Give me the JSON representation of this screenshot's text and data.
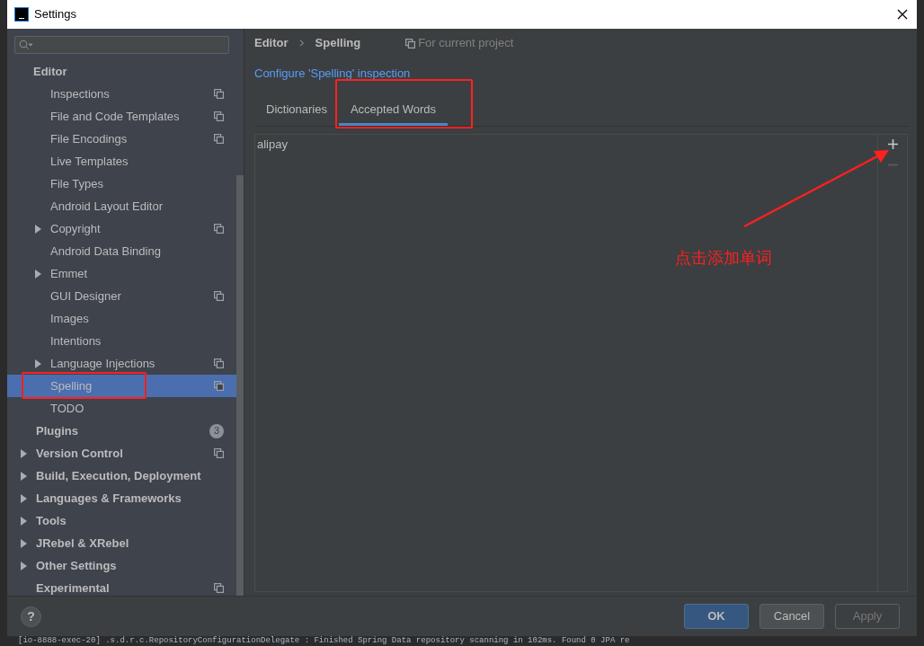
{
  "window": {
    "title": "Settings"
  },
  "help": {
    "label": "?"
  },
  "sidebar": {
    "items": [
      {
        "label": "Editor",
        "selected": false,
        "children": [
          {
            "label": "Inspections",
            "selected": false,
            "project_scope": true
          },
          {
            "label": "File and Code Templates",
            "selected": false,
            "project_scope": true
          },
          {
            "label": "File Encodings",
            "selected": false,
            "project_scope": true
          },
          {
            "label": "Live Templates",
            "selected": false
          },
          {
            "label": "File Types",
            "selected": false
          },
          {
            "label": "Android Layout Editor",
            "selected": false
          },
          {
            "label": "Copyright",
            "selected": false,
            "project_scope": true,
            "expanded": false
          },
          {
            "label": "Android Data Binding",
            "selected": false
          },
          {
            "label": "Emmet",
            "selected": false,
            "expanded": false
          },
          {
            "label": "GUI Designer",
            "selected": false,
            "project_scope": true
          },
          {
            "label": "Images",
            "selected": false
          },
          {
            "label": "Intentions",
            "selected": false
          },
          {
            "label": "Language Injections",
            "selected": false,
            "project_scope": true,
            "expanded": false
          },
          {
            "label": "Spelling",
            "selected": true,
            "project_scope": true,
            "highlighted": true
          },
          {
            "label": "TODO",
            "selected": false
          }
        ]
      },
      {
        "label": "Plugins",
        "selected": false,
        "badge": "3"
      },
      {
        "label": "Version Control",
        "selected": false,
        "project_scope": true,
        "expanded": false
      },
      {
        "label": "Build, Execution, Deployment",
        "selected": false,
        "expanded": false
      },
      {
        "label": "Languages & Frameworks",
        "selected": false,
        "expanded": false
      },
      {
        "label": "Tools",
        "selected": false,
        "expanded": false
      },
      {
        "label": "JRebel & XRebel",
        "selected": false,
        "expanded": false
      },
      {
        "label": "Other Settings",
        "selected": false,
        "expanded": false
      },
      {
        "label": "Experimental",
        "selected": false,
        "project_scope": true
      }
    ]
  },
  "breadcrumb": [
    "Editor",
    "Spelling"
  ],
  "scope_note": "For current project",
  "link": "Configure 'Spelling' inspection",
  "tabs": [
    {
      "label": "Dictionaries",
      "selected": false,
      "highlighted": false
    },
    {
      "label": "Accepted Words",
      "selected": true,
      "highlighted": true
    }
  ],
  "words": [
    "alipay"
  ],
  "list_toolbar": [
    {
      "kind": "add",
      "disabled": false
    },
    {
      "kind": "remove",
      "disabled": true
    }
  ],
  "callout": {
    "text": "点击添加单词"
  },
  "buttons": [
    {
      "label": "OK",
      "default": true,
      "disabled": false
    },
    {
      "label": "Cancel",
      "default": false,
      "disabled": false
    },
    {
      "label": "Apply",
      "default": false,
      "disabled": true
    }
  ],
  "console_line": "[io-8888-exec-20] .s.d.r.c.RepositoryConfigurationDelegate : Finished Spring Data repository scanning in 102ms. Found 0 JPA re"
}
